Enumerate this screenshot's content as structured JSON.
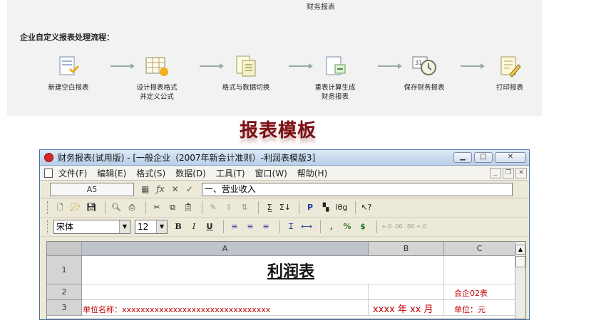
{
  "diagram": {
    "prev_row_captions": [
      "",
      "",
      "",
      "财务报表",
      ""
    ],
    "title": "企业自定义报表处理流程：",
    "steps": [
      {
        "label": "新建空白报表",
        "icon": "blank-report-icon"
      },
      {
        "label": "设计报表格式\n并定义公式",
        "icon": "design-grid-icon"
      },
      {
        "label": "格式与数据切换",
        "icon": "switch-format-icon"
      },
      {
        "label": "重表计算生成\n财务报表",
        "icon": "calculate-report-icon"
      },
      {
        "label": "保存财务报表",
        "icon": "save-clock-icon"
      },
      {
        "label": "打印报表",
        "icon": "print-report-icon"
      }
    ]
  },
  "heading": "报表模板",
  "window": {
    "title": "财务报表(试用版) - [一般企业（2007年新会计准则）-利润表模版3]",
    "caption_buttons": {
      "minimize": "▁",
      "maximize": "□",
      "close": "✕"
    },
    "menu": [
      "文件(F)",
      "编辑(E)",
      "格式(S)",
      "数据(D)",
      "工具(T)",
      "窗口(W)",
      "帮助(H)"
    ],
    "mdi_buttons": {
      "minimize": "_",
      "restore": "❐",
      "close": "✕"
    },
    "cell_ref": "A5",
    "formula_value": "一、营业收入",
    "font_name": "宋体",
    "font_size": "12",
    "columns": [
      "A",
      "B",
      "C"
    ],
    "rows": [
      {
        "num": "1",
        "a": "利润表",
        "b": "",
        "c": ""
      },
      {
        "num": "2",
        "a": "",
        "b": "",
        "c": "会企02表"
      },
      {
        "num": "3",
        "a": "单位名称：xxxxxxxxxxxxxxxxxxxxxxxxxxxxxxxx",
        "b": "xxxx 年 xx 月",
        "c": "单位：元"
      }
    ]
  },
  "colors": {
    "accent_red": "#c00000",
    "heading": "#7a0f14",
    "title_bar": "#c6d8ee"
  }
}
